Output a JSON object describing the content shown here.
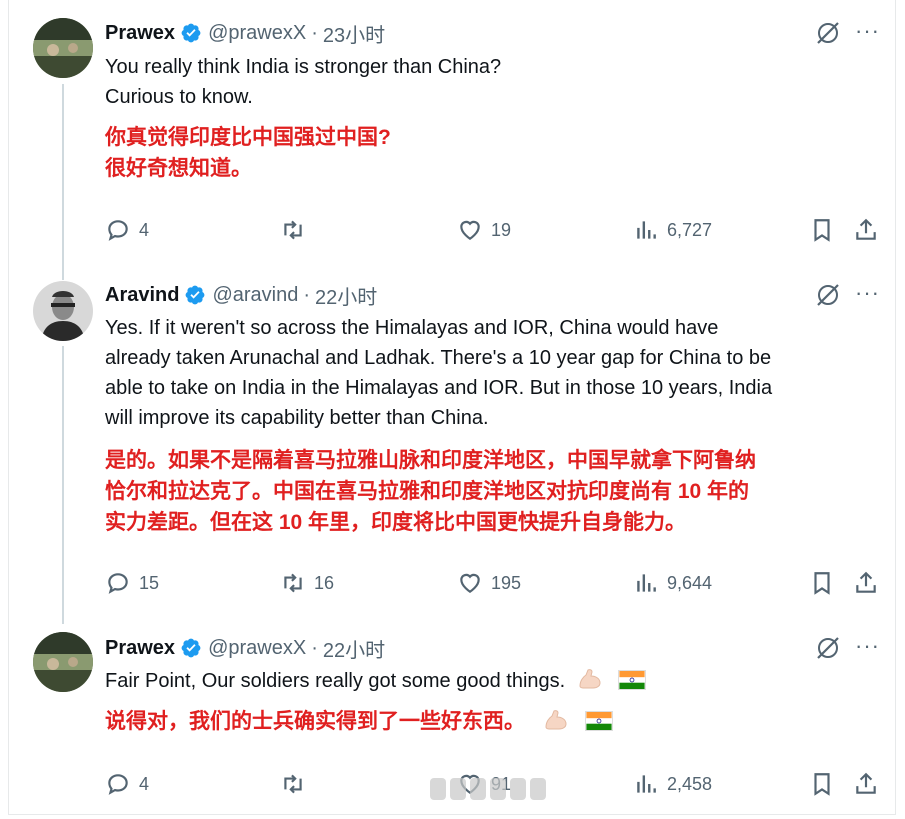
{
  "tweets": [
    {
      "name": "Prawex",
      "handle": "@prawexX",
      "dot": "·",
      "time": "23小时",
      "text_en": [
        "You really think India is stronger than China?",
        "Curious to know."
      ],
      "text_zh": [
        "你真觉得印度比中国强过中国?",
        "很好奇想知道。"
      ],
      "replies": "4",
      "retweets": "",
      "likes": "19",
      "views": "6,727"
    },
    {
      "name": "Aravind",
      "handle": "@aravind",
      "dot": "·",
      "time": "22小时",
      "text_en": [
        "Yes. If it weren't so across the Himalayas and IOR, China would have",
        "already taken Arunachal and Ladhak. There's a 10 year gap for China to be",
        "able to take on India in the Himalayas and IOR. But in those 10 years, India",
        "will improve its capability better than China."
      ],
      "text_zh": [
        "是的。如果不是隔着喜马拉雅山脉和印度洋地区，中国早就拿下阿鲁纳",
        "恰尔和拉达克了。中国在喜马拉雅和印度洋地区对抗印度尚有 10 年的",
        "实力差距。但在这 10 年里，印度将比中国更快提升自身能力。"
      ],
      "replies": "15",
      "retweets": "16",
      "likes": "195",
      "views": "9,644"
    },
    {
      "name": "Prawex",
      "handle": "@prawexX",
      "dot": "·",
      "time": "22小时",
      "text_en": [
        "Fair Point, Our soldiers really got some good things."
      ],
      "text_zh": [
        "说得对，我们的士兵确实得到了一些好东西。"
      ],
      "replies": "4",
      "retweets": "",
      "likes": "91",
      "views": "2,458"
    }
  ],
  "more_label": "···",
  "colors": {
    "accent": "#1d9bf0",
    "translation": "#e02020",
    "muted": "#536471"
  },
  "icons": [
    "verified-badge-icon",
    "grok-icon",
    "more-icon",
    "reply-icon",
    "retweet-icon",
    "like-icon",
    "views-icon",
    "bookmark-icon",
    "share-icon",
    "flexed-biceps-emoji",
    "india-flag-emoji"
  ]
}
